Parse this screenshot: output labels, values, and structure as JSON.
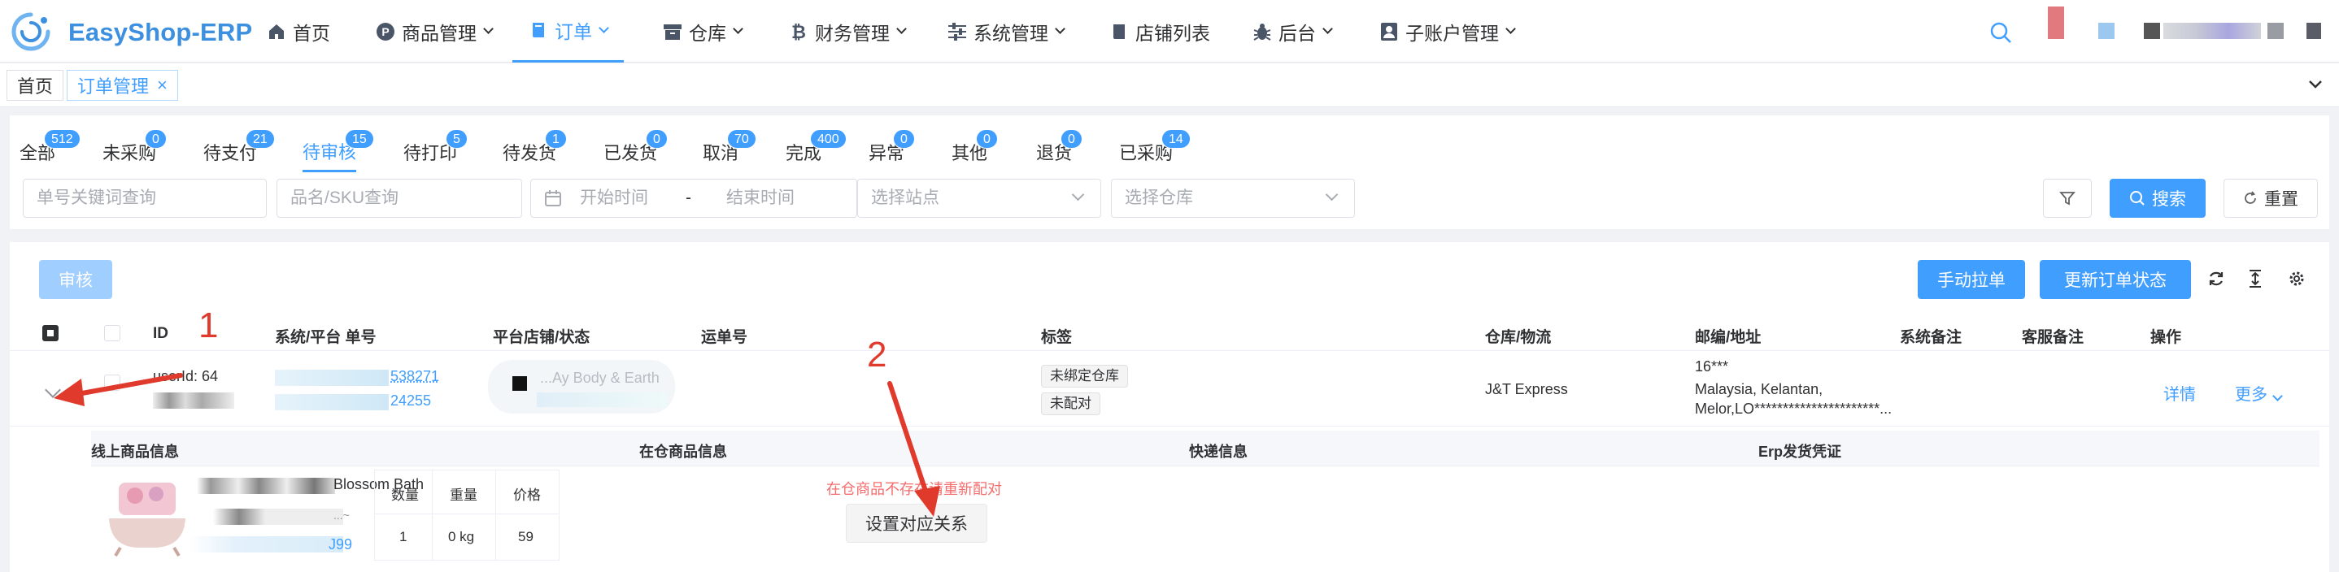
{
  "app": {
    "brand": "EasyShop-ERP"
  },
  "nav": [
    {
      "label": "首页",
      "icon": "home-icon"
    },
    {
      "label": "商品管理",
      "icon": "product-p-icon"
    },
    {
      "label": "订单",
      "icon": "book-icon"
    },
    {
      "label": "仓库",
      "icon": "warehouse-icon"
    },
    {
      "label": "财务管理",
      "icon": "bitcoin-icon"
    },
    {
      "label": "系统管理",
      "icon": "sliders-icon"
    },
    {
      "label": "店铺列表",
      "icon": "shop-icon"
    },
    {
      "label": "后台",
      "icon": "bug-icon"
    },
    {
      "label": "子账户管理",
      "icon": "user-badge-icon"
    }
  ],
  "breadcrumb_tabs": [
    {
      "label": "首页"
    },
    {
      "label": "订单管理",
      "close": "×"
    }
  ],
  "status_tabs": [
    {
      "label": "全部",
      "count": "512"
    },
    {
      "label": "未采购",
      "count": "0"
    },
    {
      "label": "待支付",
      "count": "21"
    },
    {
      "label": "待审核",
      "count": "15"
    },
    {
      "label": "待打印",
      "count": "5"
    },
    {
      "label": "待发货",
      "count": "1"
    },
    {
      "label": "已发货",
      "count": "0"
    },
    {
      "label": "取消",
      "count": "70"
    },
    {
      "label": "完成",
      "count": "400"
    },
    {
      "label": "异常",
      "count": "0"
    },
    {
      "label": "其他",
      "count": "0"
    },
    {
      "label": "退货",
      "count": "0"
    },
    {
      "label": "已采购",
      "count": "14"
    }
  ],
  "filters": {
    "order_keyword_placeholder": "单号关键词查询",
    "product_sku_placeholder": "品名/SKU查询",
    "start_time_placeholder": "开始时间",
    "range_separator": "-",
    "end_time_placeholder": "结束时间",
    "site_placeholder": "选择站点",
    "warehouse_placeholder": "选择仓库",
    "search_label": "搜索",
    "reset_label": "重置"
  },
  "toolbar": {
    "audit_label": "审核",
    "manual_pull_label": "手动拉单",
    "update_status_label": "更新订单状态"
  },
  "table": {
    "columns": [
      "ID",
      "系统/平台 单号",
      "平台店铺/状态",
      "运单号",
      "标签",
      "仓库/物流",
      "邮编/地址",
      "系统备注",
      "客服备注",
      "操作"
    ]
  },
  "order": {
    "user_id": "userId: 64",
    "order_no_partial_1": "538271",
    "order_no_partial_2": "24255",
    "shop_partial": "...Ay Body & Earth",
    "tags": [
      "未绑定仓库",
      "未配对"
    ],
    "logistics": "J&T Express",
    "postcode": "16***",
    "address_line1": "Malaysia, Kelantan,",
    "address_line2": "Melor,LO**********************...",
    "action_detail": "详情",
    "action_more": "更多"
  },
  "detail": {
    "columns": [
      "线上商品信息",
      "在仓商品信息",
      "快递信息",
      "Erp发货凭证"
    ],
    "product_name_partial": "Blossom Bath",
    "product_name_partial2": "...~",
    "sku_link_partial": "J99",
    "sub_headers": [
      "数量",
      "重量",
      "价格"
    ],
    "sub_values": [
      "1",
      "0 kg",
      "59"
    ],
    "warning": "在仓商品不存在请重新配对",
    "set_mapping_label": "设置对应关系"
  },
  "annotations": [
    "1",
    "2"
  ],
  "colors": {
    "primary": "#409eff",
    "annotation": "#e03a2c",
    "danger": "#f56c6c"
  }
}
